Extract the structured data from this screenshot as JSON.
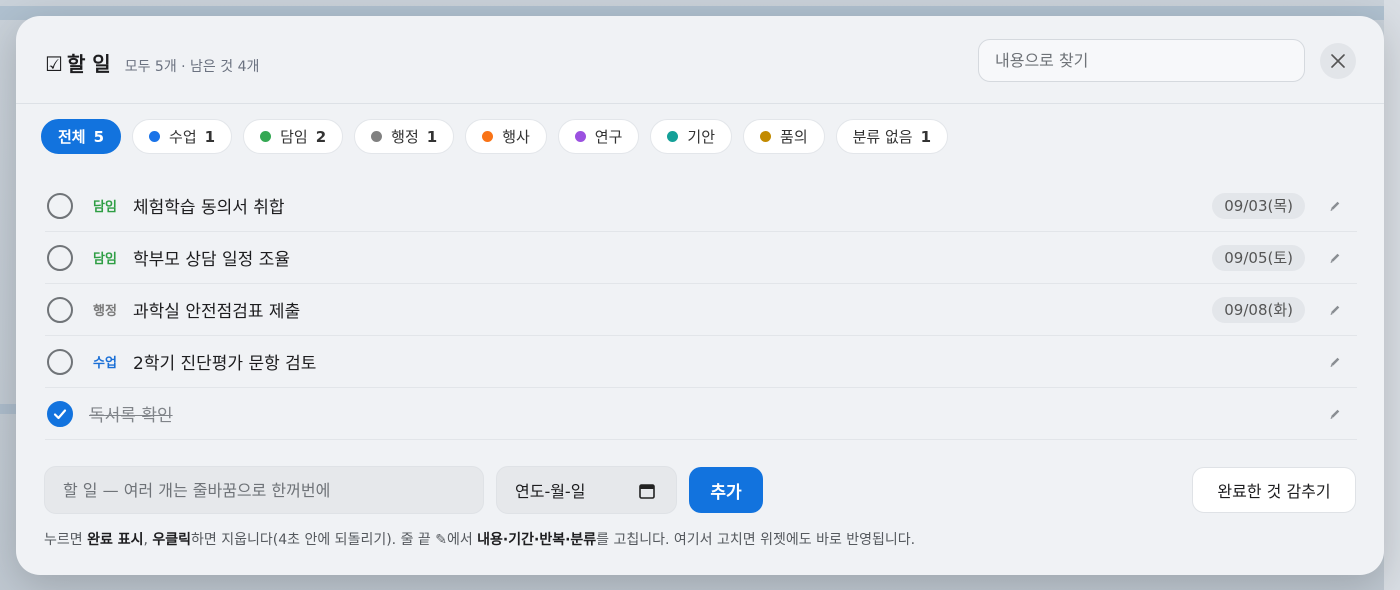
{
  "header": {
    "check_glyph": "☑",
    "title": "할 일",
    "summary": "모두 5개 · 남은 것 4개",
    "search_placeholder": "내용으로 찾기"
  },
  "filters": [
    {
      "label": "전체",
      "count": "5",
      "color": "",
      "active": true
    },
    {
      "label": "수업",
      "count": "1",
      "color": "#1a73e8"
    },
    {
      "label": "담임",
      "count": "2",
      "color": "#34a853"
    },
    {
      "label": "행정",
      "count": "1",
      "color": "#808080"
    },
    {
      "label": "행사",
      "count": "",
      "color": "#f97316"
    },
    {
      "label": "연구",
      "count": "",
      "color": "#9b51e0"
    },
    {
      "label": "기안",
      "count": "",
      "color": "#14a098"
    },
    {
      "label": "품의",
      "count": "",
      "color": "#c28a00"
    },
    {
      "label": "분류 없음",
      "count": "1",
      "color": ""
    }
  ],
  "tasks": [
    {
      "category": "담임",
      "category_color": "#2e9e44",
      "text": "체험학습 동의서 취합",
      "date": "09/03(목)",
      "done": false
    },
    {
      "category": "담임",
      "category_color": "#2e9e44",
      "text": "학부모 상담 일정 조율",
      "date": "09/05(토)",
      "done": false
    },
    {
      "category": "행정",
      "category_color": "#7a7a7a",
      "text": "과학실 안전점검표 제출",
      "date": "09/08(화)",
      "done": false
    },
    {
      "category": "수업",
      "category_color": "#1a6fd6",
      "text": "2학기 진단평가 문항 검토",
      "date": "",
      "done": false
    },
    {
      "category": "",
      "category_color": "",
      "text": "독서록 확인",
      "date": "",
      "done": true
    }
  ],
  "composer": {
    "task_placeholder": "할 일 — 여러 개는 줄바꿈으로 한꺼번에",
    "date_placeholder": "연도-월-일",
    "add_label": "추가",
    "hide_done_label": "완료한 것 감추기"
  },
  "help": {
    "p1": "누르면 ",
    "b1": "완료 표시",
    "p2": ", ",
    "b2": "우클릭",
    "p3": "하면 지웁니다(4초 안에 되돌리기). 줄 끝 ✎에서 ",
    "b3": "내용·기간·반복·분류",
    "p4": "를 고칩니다. 여기서 고치면 위젯에도 바로 반영됩니다."
  },
  "colors": {
    "accent": "#1273de"
  }
}
